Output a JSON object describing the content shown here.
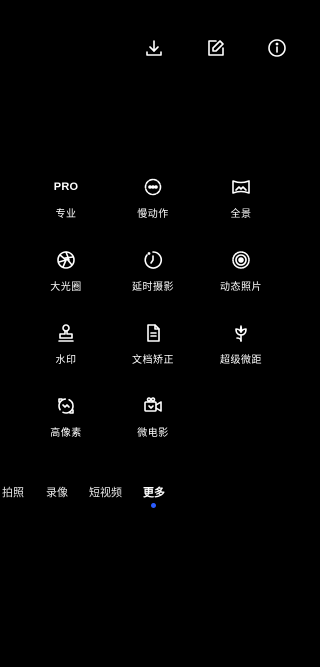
{
  "top_icons": [
    {
      "name": "download-icon"
    },
    {
      "name": "edit-icon"
    },
    {
      "name": "info-icon"
    }
  ],
  "modes": [
    {
      "label": "专业",
      "icon_text": "PRO",
      "icon": "pro-text-icon"
    },
    {
      "label": "慢动作",
      "icon": "slow-motion-icon"
    },
    {
      "label": "全景",
      "icon": "panorama-icon"
    },
    {
      "label": "大光圈",
      "icon": "aperture-icon"
    },
    {
      "label": "延时摄影",
      "icon": "timelapse-icon"
    },
    {
      "label": "动态照片",
      "icon": "live-photo-icon"
    },
    {
      "label": "水印",
      "icon": "stamp-icon"
    },
    {
      "label": "文档矫正",
      "icon": "document-icon"
    },
    {
      "label": "超级微距",
      "icon": "macro-flower-icon"
    },
    {
      "label": "高像素",
      "icon": "high-res-icon"
    },
    {
      "label": "微电影",
      "icon": "video-camera-icon"
    }
  ],
  "tabs": [
    {
      "label": "拍照"
    },
    {
      "label": "录像"
    },
    {
      "label": "短视频"
    },
    {
      "label": "更多"
    }
  ],
  "active_tab": "更多",
  "accent_color": "#2b5cff"
}
